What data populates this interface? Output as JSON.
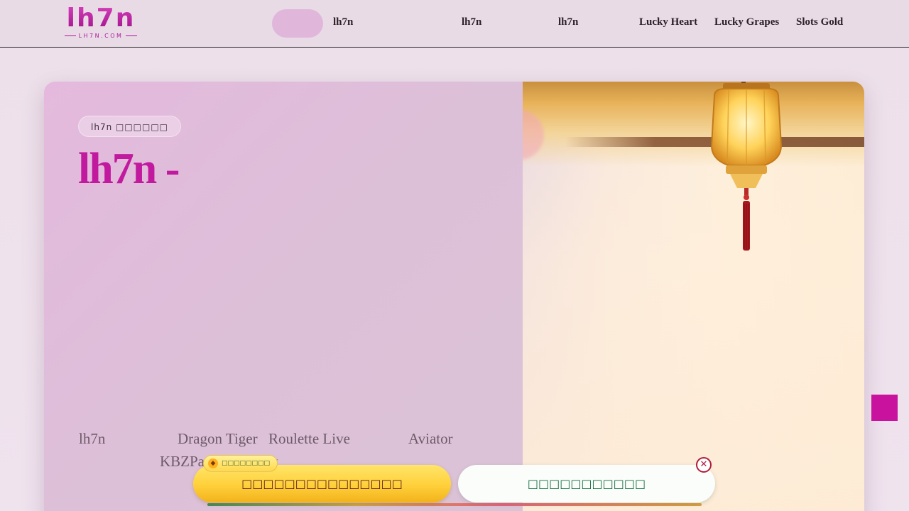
{
  "header": {
    "logo": {
      "main": "lh7n",
      "sub": "LH7N.COM"
    },
    "nav": [
      {
        "label": "lh7n"
      },
      {
        "label": "lh7n"
      },
      {
        "label": "lh7n"
      },
      {
        "label": "Lucky Heart"
      },
      {
        "label": "Lucky Grapes"
      },
      {
        "label": "Slots Gold"
      }
    ]
  },
  "hero": {
    "badge": "lh7n □□□□□□",
    "title": "lh7n -",
    "games": [
      {
        "label": "lh7n"
      },
      {
        "label": "Dragon Tiger"
      },
      {
        "label": "Roulette Live"
      },
      {
        "label": "Aviator"
      },
      {
        "label": "KBZPay"
      },
      {
        "label": "Pay"
      }
    ]
  },
  "cta": {
    "badge_icon": "gift-icon",
    "badge_text": "□□□□□□□□",
    "primary_label": "□□□□□□□□□□□□□□□",
    "secondary_label": "□□□□□□□□□□□",
    "close_symbol": "✕"
  },
  "colors": {
    "brand": "#c21a9f",
    "cta_primary": "#ffd03a",
    "cta_secondary_text": "#0f6a3a",
    "close": "#b01e3c"
  }
}
